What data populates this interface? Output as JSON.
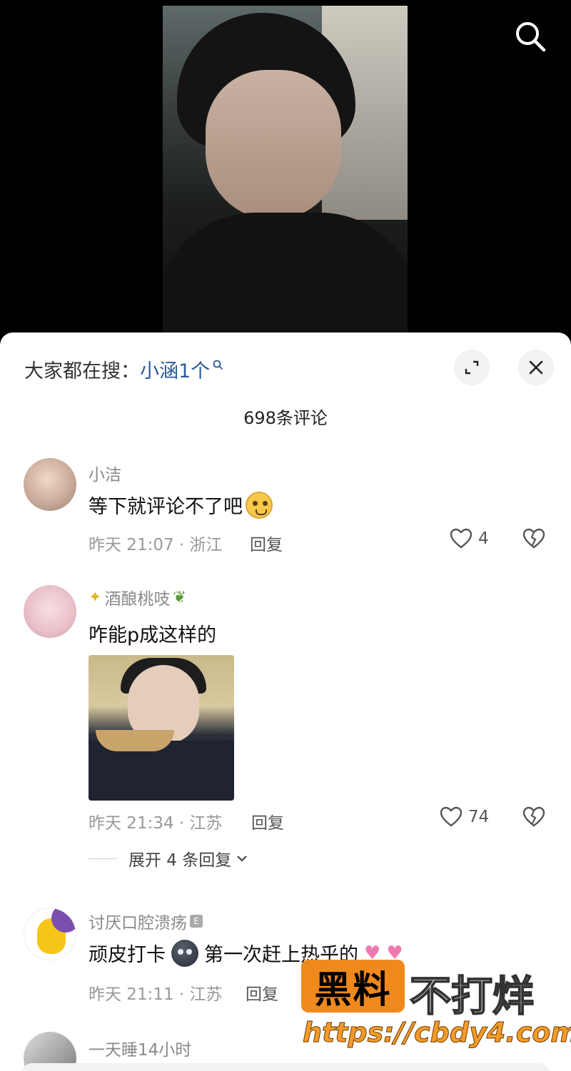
{
  "search": {
    "icon": "search-icon"
  },
  "sheet": {
    "hot_search_prefix": "大家都在搜：",
    "hot_search_term": "小涵1个",
    "comment_count": "698条评论"
  },
  "comments": [
    {
      "username": "小洁",
      "text": "等下就评论不了吧",
      "time_location": "昨天 21:07 · 浙江",
      "reply": "回复",
      "likes": "4"
    },
    {
      "username": "酒酿桃吱",
      "text": "咋能p成这样的",
      "time_location": "昨天 21:34 · 江苏",
      "reply": "回复",
      "likes": "74",
      "expand_replies": "展开 4 条回复"
    },
    {
      "username": "讨厌口腔溃疡",
      "badge": "E",
      "text_a": "顽皮打卡",
      "text_b": "第一次赶上热乎的",
      "time_location": "昨天 21:11 · 江苏",
      "reply": "回复"
    },
    {
      "username": "一天睡14小时"
    }
  ],
  "watermark": {
    "box_text": "黑料",
    "text": "不打烊",
    "url": "https://cbdy4.com"
  }
}
